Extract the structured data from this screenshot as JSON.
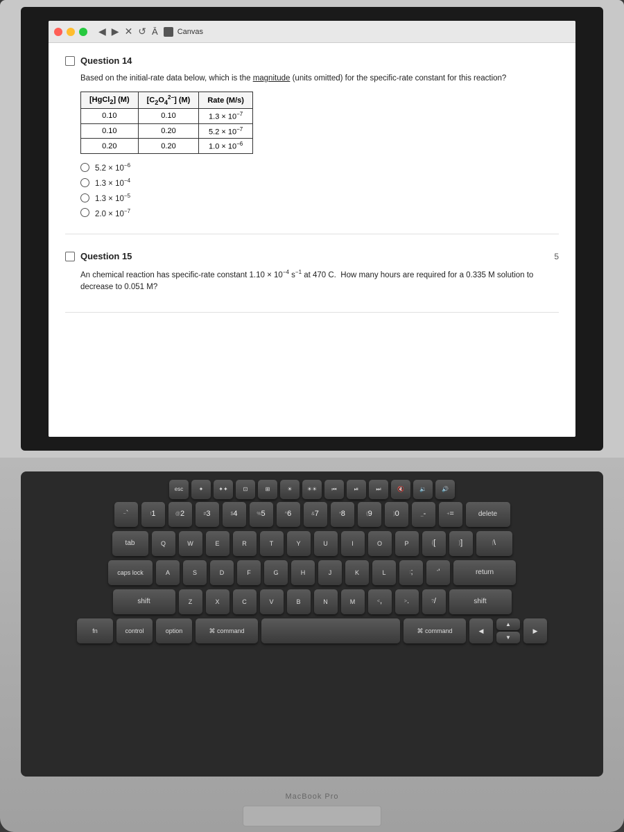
{
  "app": {
    "topbar": {
      "canvas_label": "Canvas"
    }
  },
  "question14": {
    "title": "Question 14",
    "text": "Based on the initial-rate data below, which is the magnitude (units omitted) for the specific-rate constant for this reaction?",
    "table": {
      "headers": [
        "[HgCl₂] (M)",
        "[C₂O₄²⁻] (M)",
        "Rate (M/s)"
      ],
      "rows": [
        [
          "0.10",
          "0.10",
          "1.3 × 10⁻⁷"
        ],
        [
          "0.10",
          "0.20",
          "5.2 × 10⁻⁷"
        ],
        [
          "0.20",
          "0.20",
          "1.0 × 10⁻⁶"
        ]
      ]
    },
    "options": [
      {
        "id": "a",
        "label": "5.2 × 10⁻⁶"
      },
      {
        "id": "b",
        "label": "1.3 × 10⁻⁴"
      },
      {
        "id": "c",
        "label": "1.3 × 10⁻⁵"
      },
      {
        "id": "d",
        "label": "2.0 × 10⁻⁷"
      }
    ]
  },
  "question15": {
    "title": "Question 15",
    "points": "5",
    "text": "An chemical reaction has specific-rate constant 1.10 × 10⁻⁴ s⁻¹ at 470 C. How many hours are required for a 0.335 M solution to decrease to 0.051 M?"
  },
  "macbook_label": "MacBook Pro",
  "keyboard": {
    "row_fn": [
      "esc",
      "F1",
      "F2",
      "F3",
      "F4",
      "F5",
      "F6",
      "F7",
      "F8",
      "F9",
      "F10",
      "F11",
      "F12"
    ],
    "row1": [
      "~`",
      "!1",
      "@2",
      "#3",
      "$4",
      "%5",
      "^6",
      "&7",
      "*8",
      "(9",
      ")0",
      "-_",
      "=+",
      "delete"
    ],
    "row2": [
      "tab",
      "Q",
      "W",
      "E",
      "R",
      "T",
      "Y",
      "U",
      "I",
      "O",
      "P",
      "[{",
      "]}",
      "\\|"
    ],
    "row3": [
      "caps",
      "A",
      "S",
      "D",
      "F",
      "G",
      "H",
      "J",
      "K",
      "L",
      ";:",
      "'\"",
      "return"
    ],
    "row4": [
      "shift",
      "Z",
      "X",
      "C",
      "V",
      "B",
      "N",
      "M",
      ",<",
      ".>",
      "/?",
      "shift"
    ],
    "row5": [
      "fn",
      "control",
      "option",
      "command",
      "space",
      "command",
      "◄",
      "▼",
      "▲",
      "►"
    ]
  }
}
